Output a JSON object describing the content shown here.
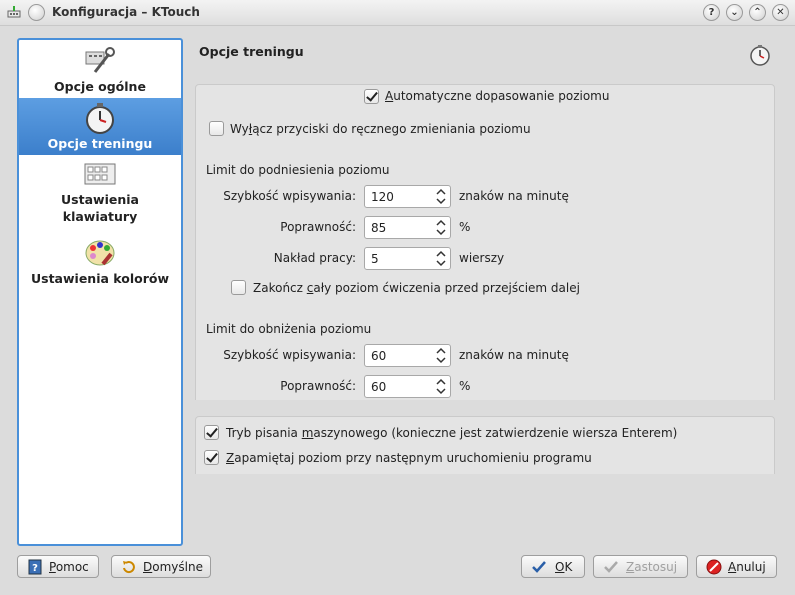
{
  "window": {
    "title": "Konfiguracja – KTouch",
    "buttons": [
      "?",
      "⌄",
      "⌃",
      "✕"
    ]
  },
  "sidebar": {
    "items": [
      {
        "label": "Opcje ogólne",
        "icon": "tools-icon"
      },
      {
        "label": "Opcje treningu",
        "icon": "stopwatch-icon",
        "selected": true
      },
      {
        "label_line1": "Ustawienia",
        "label_line2": "klawiatury",
        "icon": "keyboard-icon"
      },
      {
        "label": "Ustawienia kolorów",
        "icon": "palette-icon"
      }
    ]
  },
  "panel": {
    "title": "Opcje treningu",
    "auto_adjust": {
      "u": "A",
      "rest": "utomatyczne dopasowanie poziomu",
      "checked": true
    },
    "disable_buttons": {
      "pre": "Wy",
      "u": "ł",
      "rest": "ącz przyciski do ręcznego zmieniania poziomu",
      "checked": false
    },
    "raise": {
      "heading": "Limit do podniesienia poziomu",
      "speed_label": "Szybkość wpisywania:",
      "speed_value": "120",
      "speed_unit": "znaków na minutę",
      "accuracy_label": "Poprawność:",
      "accuracy_value": "85",
      "accuracy_unit": "%",
      "workload_label": "Nakład pracy:",
      "workload_value": "5",
      "workload_unit": "wierszy",
      "complete_level": {
        "pre": "Zakończ ",
        "u": "c",
        "rest": "ały poziom ćwiczenia przed przejściem dalej",
        "checked": false
      }
    },
    "lower": {
      "heading": "Limit do obniżenia poziomu",
      "speed_label": "Szybkość wpisywania:",
      "speed_value": "60",
      "speed_unit": "znaków na minutę",
      "accuracy_label": "Poprawność:",
      "accuracy_value": "60",
      "accuracy_unit": "%"
    },
    "typewriter": {
      "pre": "Tryb pisania ",
      "u": "m",
      "rest": "aszynowego (konieczne jest zatwierdzenie wiersza Enterem)",
      "checked": true
    },
    "remember": {
      "pre": "",
      "u": "Z",
      "rest": "apamiętaj poziom przy następnym uruchomieniu programu",
      "checked": true
    }
  },
  "footer": {
    "help": {
      "u": "P",
      "rest": "omoc"
    },
    "defaults": {
      "u": "D",
      "rest": "omyślne"
    },
    "ok": {
      "u": "O",
      "rest": "K"
    },
    "apply": {
      "u": "Z",
      "rest": "astosuj"
    },
    "cancel": {
      "u": "A",
      "rest": "nuluj"
    }
  }
}
